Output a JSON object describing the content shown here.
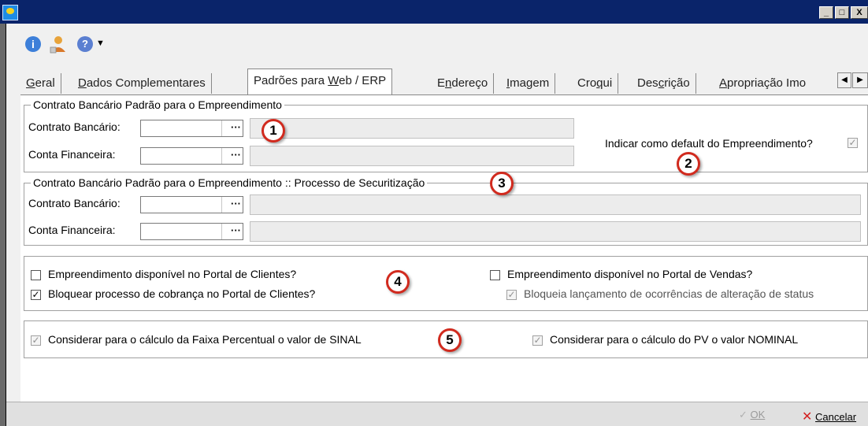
{
  "window": {
    "minimize_glyph": "_",
    "maximize_glyph": "□",
    "close_glyph": "X"
  },
  "toolbar": {
    "info_glyph": "i",
    "help_glyph": "?",
    "dropdown_glyph": "▼"
  },
  "tabs": [
    {
      "pre": "",
      "ul": "G",
      "post": "eral"
    },
    {
      "pre": "",
      "ul": "D",
      "post": "ados Complementares"
    },
    {
      "pre": "Padrões para ",
      "ul": "W",
      "post": "eb / ERP"
    },
    {
      "pre": "E",
      "ul": "n",
      "post": "dereço"
    },
    {
      "pre": "",
      "ul": "I",
      "post": "magem"
    },
    {
      "pre": "Cro",
      "ul": "q",
      "post": "ui"
    },
    {
      "pre": "Des",
      "ul": "c",
      "post": "rição"
    },
    {
      "pre": "",
      "ul": "A",
      "post": "propriação Imo"
    }
  ],
  "tab_scroll": {
    "left": "◀",
    "right": "▶"
  },
  "group1": {
    "legend": "Contrato Bancário Padrão para o Empreendimento",
    "contrato_label": "Contrato Bancário:",
    "conta_label": "Conta Financeira:",
    "contrato_value": "",
    "conta_value": "",
    "lookup_glyph": "···",
    "default_label": "Indicar como default do Empreendimento?",
    "default_checked": true
  },
  "group2": {
    "legend": "Contrato Bancário Padrão para o Empreendimento  :: Processo de Securitização",
    "contrato_label": "Contrato Bancário:",
    "conta_label": "Conta Financeira:",
    "lookup_glyph": "···"
  },
  "group4": {
    "portal_clientes": {
      "label": "Empreendimento disponível no Portal de Clientes?",
      "checked": false
    },
    "bloquear_cobranca": {
      "label": "Bloquear processo de cobrança no Portal de Clientes?",
      "checked": true
    },
    "portal_vendas": {
      "label": "Empreendimento disponível no Portal de Vendas?",
      "checked": false
    },
    "bloqueia_ocorrencias": {
      "label": "Bloqueia lançamento de ocorrências de alteração de status",
      "checked": true
    }
  },
  "group5": {
    "faixa_sinal": {
      "label": "Considerar para o cálculo da Faixa Percentual o valor de SINAL",
      "checked": true
    },
    "pv_nominal": {
      "label": "Considerar para o cálculo do PV o valor NOMINAL",
      "checked": true
    }
  },
  "badges": [
    "1",
    "2",
    "3",
    "4",
    "5"
  ],
  "footer": {
    "ok_label": "OK",
    "cancel_label": "Cancelar"
  },
  "colors": {
    "titlebar": "#0a246a",
    "badge_border": "#d12a1e",
    "cancel_x": "#d32020"
  }
}
